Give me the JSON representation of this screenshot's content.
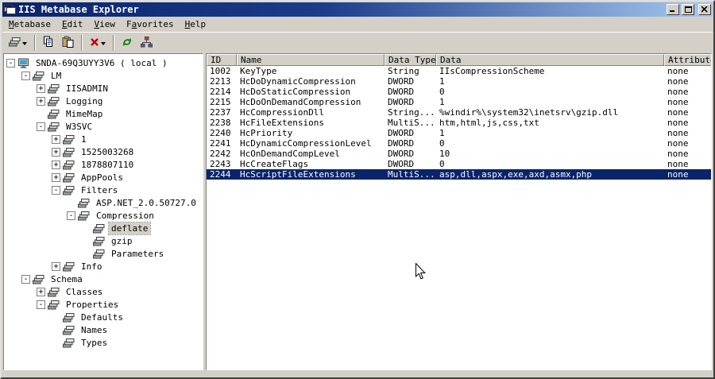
{
  "window": {
    "title": "IIS Metabase Explorer"
  },
  "menu": {
    "items": [
      {
        "label": "Metabase",
        "underline": 0
      },
      {
        "label": "Edit",
        "underline": 0
      },
      {
        "label": "View",
        "underline": 0
      },
      {
        "label": "Favorites",
        "underline": 1
      },
      {
        "label": "Help",
        "underline": 0
      }
    ]
  },
  "toolbar": {
    "buttons": [
      {
        "name": "new-key",
        "icon": "stack",
        "dropdown": true
      },
      {
        "sep": true
      },
      {
        "name": "copy",
        "icon": "copy"
      },
      {
        "name": "paste",
        "icon": "paste"
      },
      {
        "sep": true
      },
      {
        "name": "delete",
        "icon": "delete",
        "dropdown": true
      },
      {
        "sep": true
      },
      {
        "name": "refresh",
        "icon": "refresh"
      },
      {
        "name": "view-network",
        "icon": "network"
      }
    ]
  },
  "tree": {
    "items": [
      {
        "label": "SNDA-69Q3UYY3V6 ( local )",
        "depth": 0,
        "expand": "minus",
        "icon": "computer",
        "selected": false
      },
      {
        "label": "LM",
        "depth": 1,
        "expand": "minus",
        "icon": "stack",
        "selected": false
      },
      {
        "label": "IISADMIN",
        "depth": 2,
        "expand": "plus",
        "icon": "stack",
        "selected": false
      },
      {
        "label": "Logging",
        "depth": 2,
        "expand": "plus",
        "icon": "stack",
        "selected": false
      },
      {
        "label": "MimeMap",
        "depth": 2,
        "expand": "",
        "icon": "stack",
        "selected": false
      },
      {
        "label": "W3SVC",
        "depth": 2,
        "expand": "minus",
        "icon": "stack",
        "selected": false
      },
      {
        "label": "1",
        "depth": 3,
        "expand": "plus",
        "icon": "stack",
        "selected": false
      },
      {
        "label": "1525003268",
        "depth": 3,
        "expand": "plus",
        "icon": "stack",
        "selected": false
      },
      {
        "label": "1878807110",
        "depth": 3,
        "expand": "plus",
        "icon": "stack",
        "selected": false
      },
      {
        "label": "AppPools",
        "depth": 3,
        "expand": "plus",
        "icon": "stack",
        "selected": false
      },
      {
        "label": "Filters",
        "depth": 3,
        "expand": "minus",
        "icon": "stack",
        "selected": false
      },
      {
        "label": "ASP.NET_2.0.50727.0",
        "depth": 4,
        "expand": "",
        "icon": "stack",
        "selected": false
      },
      {
        "label": "Compression",
        "depth": 4,
        "expand": "minus",
        "icon": "stack",
        "selected": false
      },
      {
        "label": "deflate",
        "depth": 5,
        "expand": "",
        "icon": "stack",
        "selected": true
      },
      {
        "label": "gzip",
        "depth": 5,
        "expand": "",
        "icon": "stack",
        "selected": false
      },
      {
        "label": "Parameters",
        "depth": 5,
        "expand": "",
        "icon": "stack",
        "selected": false
      },
      {
        "label": "Info",
        "depth": 3,
        "expand": "plus",
        "icon": "stack",
        "selected": false
      },
      {
        "label": "Schema",
        "depth": 1,
        "expand": "minus",
        "icon": "stack",
        "selected": false
      },
      {
        "label": "Classes",
        "depth": 2,
        "expand": "plus",
        "icon": "stack",
        "selected": false
      },
      {
        "label": "Properties",
        "depth": 2,
        "expand": "minus",
        "icon": "stack",
        "selected": false
      },
      {
        "label": "Defaults",
        "depth": 3,
        "expand": "",
        "icon": "stack",
        "selected": false
      },
      {
        "label": "Names",
        "depth": 3,
        "expand": "",
        "icon": "stack",
        "selected": false
      },
      {
        "label": "Types",
        "depth": 3,
        "expand": "",
        "icon": "stack",
        "selected": false
      }
    ]
  },
  "list": {
    "columns": [
      "ID",
      "Name",
      "Data Type",
      "Data",
      "Attributes"
    ],
    "selected_index": 10,
    "rows": [
      [
        "1002",
        "KeyType",
        "String",
        "IIsCompressionScheme",
        "none"
      ],
      [
        "2213",
        "HcDoDynamicCompression",
        "DWORD",
        "1",
        "none"
      ],
      [
        "2214",
        "HcDoStaticCompression",
        "DWORD",
        "0",
        "none"
      ],
      [
        "2215",
        "HcDoOnDemandCompression",
        "DWORD",
        "1",
        "none"
      ],
      [
        "2237",
        "HcCompressionDll",
        "String...",
        "%windir%\\system32\\inetsrv\\gzip.dll",
        "none"
      ],
      [
        "2238",
        "HcFileExtensions",
        "MultiS...",
        "htm,html,js,css,txt",
        "none"
      ],
      [
        "2240",
        "HcPriority",
        "DWORD",
        "1",
        "none"
      ],
      [
        "2241",
        "HcDynamicCompressionLevel",
        "DWORD",
        "0",
        "none"
      ],
      [
        "2242",
        "HcOnDemandCompLevel",
        "DWORD",
        "10",
        "none"
      ],
      [
        "2243",
        "HcCreateFlags",
        "DWORD",
        "0",
        "none"
      ],
      [
        "2244",
        "HcScriptFileExtensions",
        "MultiS...",
        "asp,dll,aspx,exe,axd,asmx,php",
        "none"
      ]
    ]
  }
}
